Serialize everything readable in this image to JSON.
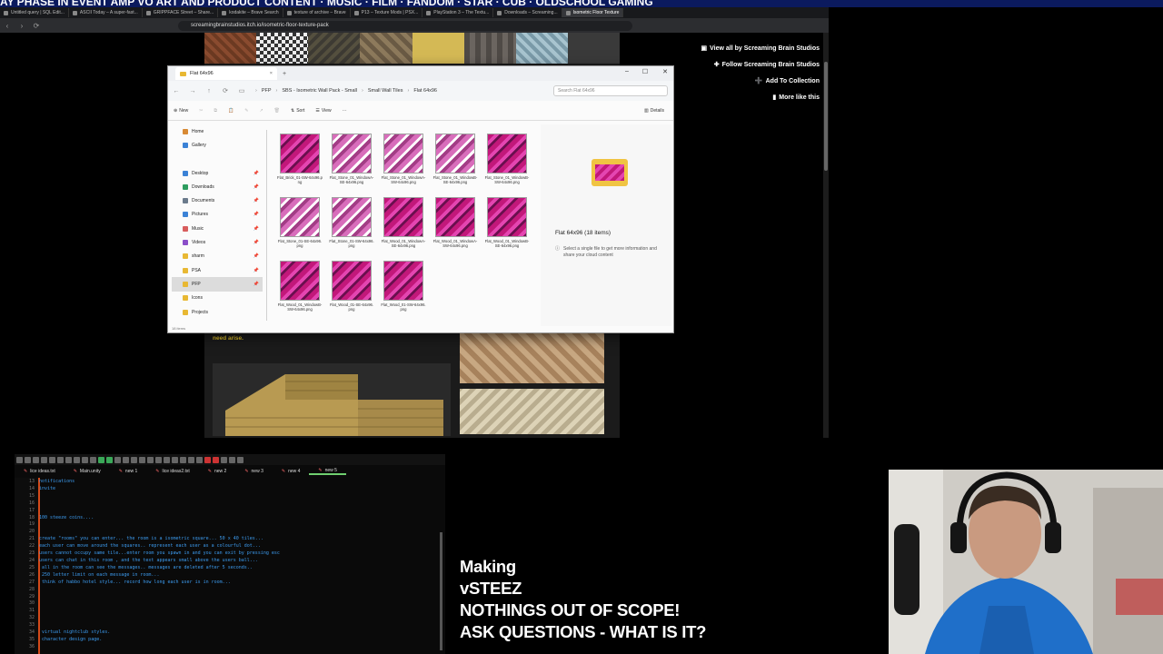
{
  "ticker": {
    "text": "AY PHASE IN EVENT AMP VO ART AND PRODUCT CONTENT · MUSIC · FILM · FANDOM · STAR · CUB · OLDSCHOOL GAMING"
  },
  "browser": {
    "tabs": [
      {
        "label": "Untitled query | SQL Edit...",
        "active": false
      },
      {
        "label": "ASCII Today – A super-fast...",
        "active": false
      },
      {
        "label": "GRIPPFACE Street – Share...",
        "active": false
      },
      {
        "label": "kodakite – Brave Search",
        "active": false
      },
      {
        "label": "texture of archive – Brave",
        "active": false
      },
      {
        "label": "P13 – Texture Mods | PSX...",
        "active": false
      },
      {
        "label": "PlayStation 3 – The Textu...",
        "active": false
      },
      {
        "label": "Downloads – Screaming...",
        "active": false
      },
      {
        "label": "Isometric Floor Texture",
        "active": true
      }
    ],
    "url": "screamingbrainstudios.itch.io/isometric-floor-texture-pack",
    "sidebar_links": [
      {
        "icon": "author-icon",
        "label": "View all by Screaming Brain Studios"
      },
      {
        "icon": "follow-icon",
        "label": "Follow Screaming Brain Studios"
      },
      {
        "icon": "collection-icon",
        "label": "Add To Collection"
      },
      {
        "icon": "more-icon",
        "label": "More like this"
      }
    ],
    "page_text": "means you can still flip or mirror each texture to get another variation, should the need arise."
  },
  "explorer": {
    "tab_title": "Flat 64x96",
    "breadcrumbs": [
      "PFP",
      "SBS - Isometric Wall Pack - Small",
      "Small Wall Tiles",
      "Flat 64x96"
    ],
    "search_placeholder": "Search Flat 64x96",
    "commands": [
      "New",
      "Sort",
      "View",
      "···"
    ],
    "details_label": "Details",
    "nav_items": [
      {
        "label": "Home",
        "color": "#d88a34",
        "pinned": false,
        "selected": false
      },
      {
        "label": "Gallery",
        "color": "#3b82d6",
        "pinned": false,
        "selected": false
      },
      {
        "label": "",
        "color": "#fbfbfb",
        "pinned": false,
        "selected": false
      },
      {
        "label": "Desktop",
        "color": "#3b82d6",
        "pinned": true,
        "selected": false
      },
      {
        "label": "Downloads",
        "color": "#2d9d5f",
        "pinned": true,
        "selected": false
      },
      {
        "label": "Documents",
        "color": "#6b7b8c",
        "pinned": true,
        "selected": false
      },
      {
        "label": "Pictures",
        "color": "#3b82d6",
        "pinned": true,
        "selected": false
      },
      {
        "label": "Music",
        "color": "#d85d5d",
        "pinned": true,
        "selected": false
      },
      {
        "label": "Videos",
        "color": "#8b4fc9",
        "pinned": true,
        "selected": false
      },
      {
        "label": "sharm",
        "color": "#e8b833",
        "pinned": true,
        "selected": false
      },
      {
        "label": "PSA",
        "color": "#e8b833",
        "pinned": true,
        "selected": false
      },
      {
        "label": "PFP",
        "color": "#e8b833",
        "pinned": true,
        "selected": true
      },
      {
        "label": "Icons",
        "color": "#e8b833",
        "pinned": false,
        "selected": false
      },
      {
        "label": "Projects",
        "color": "#e8b833",
        "pinned": false,
        "selected": false
      }
    ],
    "files": [
      {
        "name": "Flat_Brick_01-SW-64x96.png",
        "light": false
      },
      {
        "name": "Flat_Stone_01_WindowA-SE-64x96.png",
        "light": true
      },
      {
        "name": "Flat_Stone_01_WindowA-SW-64x96.png",
        "light": true
      },
      {
        "name": "Flat_Stone_01_WindowB-SE-64x96.png",
        "light": true
      },
      {
        "name": "Flat_Stone_01_WindowB-SW-64x96.png",
        "light": false
      },
      {
        "name": "Flat_Stone_01-SE-64x96.png",
        "light": true
      },
      {
        "name": "Flat_Stone_01-SW-64x96.png",
        "light": true
      },
      {
        "name": "Flat_Wood_01_WindowA-SE-64x96.png",
        "light": false
      },
      {
        "name": "Flat_Wood_01_WindowA-SW-64x96.png",
        "light": false
      },
      {
        "name": "Flat_Wood_01_WindowB-SE-64x96.png",
        "light": false
      },
      {
        "name": "Flat_Wood_01_WindowB-SW-64x96.png",
        "light": false
      },
      {
        "name": "Flat_Wood_01-SE-64x96.png",
        "light": false
      },
      {
        "name": "Flat_Wood_01-SW-64x96.png",
        "light": false
      }
    ],
    "details_title": "Flat 64x96 (18 items)",
    "details_info": "Select a single file to get more information and share your cloud content",
    "status": "18 items"
  },
  "notepad": {
    "tabs": [
      {
        "label": "lice ideas.txt",
        "active": false
      },
      {
        "label": "Main.unity",
        "active": false
      },
      {
        "label": "new 1",
        "active": false
      },
      {
        "label": "lice ideas2.txt",
        "active": false
      },
      {
        "label": "new 2",
        "active": false
      },
      {
        "label": "new 3",
        "active": false
      },
      {
        "label": "new 4",
        "active": false
      },
      {
        "label": "new 5",
        "active": true
      }
    ],
    "line_numbers": "13\n14\n15\n16\n17\n18\n19\n20\n21\n22\n23\n24\n25\n26\n27\n28\n29\n30\n31\n32\n33\n34\n35\n36",
    "content": "notifications\ninvite\n\n\n\n100 steeze coins....\n\n\ncreate \"rooms\" you can enter... the room is a isometric square... 50 x 40 tiles...\neach user can move around the squares.. represent each user as a colourful dot...\nusers cannot occupy same tile...enter room you spawn in and you can exit by pressing esc\nusers can chat in this room , and the text appears small above the users ball...\n all in the room can see the messages.. messages are deleted after 5 seconds..\n 250 letter limit on each message in room...\n think of habbo hotel style... record how long each user is in room...\n\n\n\n\n\n\n virtual nightclub styles.\n character design page."
  },
  "overlay": {
    "lines": [
      "Making",
      "vSTEEZ",
      "NOTHINGS OUT OF SCOPE!",
      "ASK QUESTIONS - WHAT IS IT?"
    ]
  }
}
